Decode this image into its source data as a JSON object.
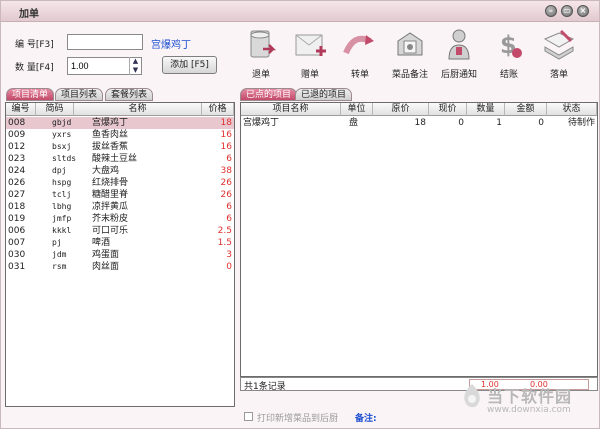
{
  "window": {
    "title": "加单"
  },
  "form": {
    "code_label": "编  号[F3]",
    "code_value": "",
    "item_name": "宫爆鸡丁",
    "qty_label": "数  量[F4]",
    "qty_value": "1.00",
    "add_button": "添加 [F5]"
  },
  "toolbar": {
    "items": [
      {
        "label": "退单",
        "icon": "return-icon"
      },
      {
        "label": "赠单",
        "icon": "gift-icon"
      },
      {
        "label": "转单",
        "icon": "transfer-icon"
      },
      {
        "label": "菜品备注",
        "icon": "dish-note-icon"
      },
      {
        "label": "后厨通知",
        "icon": "kitchen-notify-icon"
      },
      {
        "label": "结账",
        "icon": "checkout-icon"
      },
      {
        "label": "落单",
        "icon": "submit-order-icon"
      }
    ]
  },
  "left_tabs": [
    {
      "label": "项目清单"
    },
    {
      "label": "项目列表"
    },
    {
      "label": "套餐列表"
    }
  ],
  "right_tabs": [
    {
      "label": "已点的项目"
    },
    {
      "label": "已退的项目"
    }
  ],
  "menu_table": {
    "columns": [
      "编号",
      "简码",
      "名称",
      "价格"
    ],
    "rows": [
      {
        "id": "008",
        "code": "gbjd",
        "name": "宫爆鸡丁",
        "price": "18"
      },
      {
        "id": "009",
        "code": "yxrs",
        "name": "鱼香肉丝",
        "price": "16"
      },
      {
        "id": "012",
        "code": "bsxj",
        "name": "拔丝香蕉",
        "price": "16"
      },
      {
        "id": "023",
        "code": "sltds",
        "name": "酸辣土豆丝",
        "price": "6"
      },
      {
        "id": "024",
        "code": "dpj",
        "name": "大盘鸡",
        "price": "38"
      },
      {
        "id": "026",
        "code": "hspg",
        "name": "红烧排骨",
        "price": "26"
      },
      {
        "id": "027",
        "code": "tclj",
        "name": "糖醋里脊",
        "price": "26"
      },
      {
        "id": "018",
        "code": "lbhg",
        "name": "凉拌黄瓜",
        "price": "6"
      },
      {
        "id": "019",
        "code": "jmfp",
        "name": "芥末粉皮",
        "price": "6"
      },
      {
        "id": "006",
        "code": "kkkl",
        "name": "可口可乐",
        "price": "2.5"
      },
      {
        "id": "007",
        "code": "pj",
        "name": "啤酒",
        "price": "1.5"
      },
      {
        "id": "030",
        "code": "jdm",
        "name": "鸡蛋面",
        "price": "3"
      },
      {
        "id": "031",
        "code": "rsm",
        "name": "肉丝面",
        "price": "0"
      }
    ]
  },
  "order_table": {
    "columns": [
      "项目名称",
      "单位",
      "原价",
      "现价",
      "数量",
      "金额",
      "状态"
    ],
    "rows": [
      {
        "name": "宫爆鸡丁",
        "unit": "盘",
        "orig_price": "18",
        "cur_price": "0",
        "qty": "1",
        "amount": "0",
        "status": "待制作"
      }
    ]
  },
  "footer": {
    "record_count": "共1条记录",
    "sum_qty": "1.00",
    "sum_amount": "0.00",
    "print_label": "打印新增菜品到后厨",
    "note_label": "备注:"
  },
  "watermark": {
    "name": "当下软件园",
    "url": "www.downxia.com"
  },
  "colors": {
    "accent": "#c24a6a",
    "selected_row": "#e8c7cf",
    "price_red": "#e03030",
    "link_blue": "#1c4fd1"
  }
}
